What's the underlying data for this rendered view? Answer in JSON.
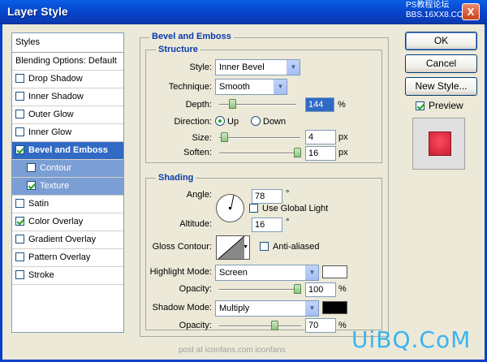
{
  "window": {
    "title": "Layer Style",
    "close": "X",
    "watermark_top": "PS教程论坛\nBBS.16XX8.COM"
  },
  "sidebar": {
    "header": "Styles",
    "items": [
      {
        "label": "Blending Options: Default",
        "checkbox": false
      },
      {
        "label": "Drop Shadow",
        "checkbox": true,
        "checked": false
      },
      {
        "label": "Inner Shadow",
        "checkbox": true,
        "checked": false
      },
      {
        "label": "Outer Glow",
        "checkbox": true,
        "checked": false
      },
      {
        "label": "Inner Glow",
        "checkbox": true,
        "checked": false
      },
      {
        "label": "Bevel and Emboss",
        "checkbox": true,
        "checked": true,
        "selected": true
      },
      {
        "label": "Contour",
        "checkbox": true,
        "checked": false,
        "sub": true
      },
      {
        "label": "Texture",
        "checkbox": true,
        "checked": true,
        "sub": true
      },
      {
        "label": "Satin",
        "checkbox": true,
        "checked": false
      },
      {
        "label": "Color Overlay",
        "checkbox": true,
        "checked": true
      },
      {
        "label": "Gradient Overlay",
        "checkbox": true,
        "checked": false
      },
      {
        "label": "Pattern Overlay",
        "checkbox": true,
        "checked": false
      },
      {
        "label": "Stroke",
        "checkbox": true,
        "checked": false
      }
    ]
  },
  "bevel": {
    "title": "Bevel and Emboss",
    "structure_title": "Structure",
    "style_label": "Style:",
    "style_value": "Inner Bevel",
    "technique_label": "Technique:",
    "technique_value": "Smooth",
    "depth_label": "Depth:",
    "depth_value": "144",
    "depth_unit": "%",
    "depth_level": 0.14,
    "direction_label": "Direction:",
    "direction_up": "Up",
    "direction_down": "Down",
    "size_label": "Size:",
    "size_value": "4",
    "size_unit": "px",
    "size_level": 0.02,
    "soften_label": "Soften:",
    "soften_value": "16",
    "soften_unit": "px",
    "soften_level": 1.0
  },
  "shading": {
    "title": "Shading",
    "angle_label": "Angle:",
    "angle_value": "78",
    "angle_unit": "°",
    "global_light": "Use Global Light",
    "altitude_label": "Altitude:",
    "altitude_value": "16",
    "altitude_unit": "°",
    "gloss_label": "Gloss Contour:",
    "anti_aliased": "Anti-aliased",
    "highlight_label": "Highlight Mode:",
    "highlight_value": "Screen",
    "highlight_color": "#ffffff",
    "hl_opacity_label": "Opacity:",
    "hl_opacity_value": "100",
    "hl_opacity_unit": "%",
    "hl_opacity_level": 1.0,
    "shadow_label": "Shadow Mode:",
    "shadow_value": "Multiply",
    "shadow_color": "#000000",
    "sh_opacity_label": "Opacity:",
    "sh_opacity_value": "70",
    "sh_opacity_unit": "%",
    "sh_opacity_level": 0.7
  },
  "buttons": {
    "ok": "OK",
    "cancel": "Cancel",
    "new_style": "New Style...",
    "preview": "Preview"
  },
  "preview_color": "#e8334a",
  "watermarks": {
    "logo": "UiBQ.CoM",
    "post": "post at iconfans.com  iconfans"
  }
}
